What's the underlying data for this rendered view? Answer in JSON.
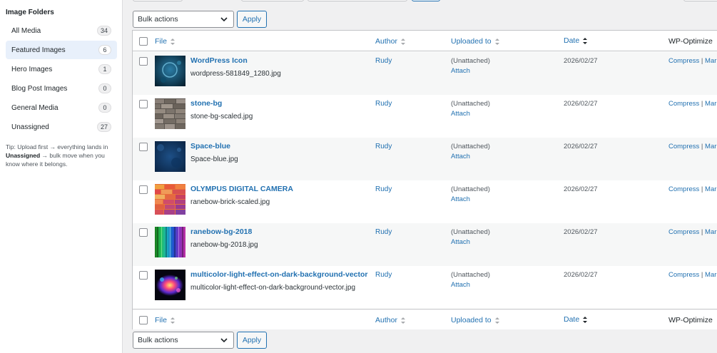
{
  "sidebar": {
    "title": "Image Folders",
    "folders": [
      {
        "label": "All Media",
        "count": "34"
      },
      {
        "label": "Featured Images",
        "count": "6"
      },
      {
        "label": "Hero Images",
        "count": "1"
      },
      {
        "label": "Blog Post Images",
        "count": "0"
      },
      {
        "label": "General Media",
        "count": "0"
      },
      {
        "label": "Unassigned",
        "count": "27"
      }
    ],
    "tip": {
      "part1": "Tip: Upload first → everything lands in ",
      "bold": "Unassigned",
      "part2": " → bulk move when you know where it belongs."
    }
  },
  "toolbar_top": {
    "bulk_label": "Bulk actions",
    "apply_label": "Apply"
  },
  "toolbar_bottom": {
    "bulk_label": "Bulk actions",
    "apply_label": "Apply"
  },
  "columns": {
    "file": "File",
    "author": "Author",
    "uploaded_to": "Uploaded to",
    "date": "Date",
    "wpo": "WP-Optimize"
  },
  "rows": [
    {
      "title": "WordPress Icon",
      "filename": "wordpress-581849_1280.jpg",
      "author": "Rudy",
      "uploaded": "(Unattached)",
      "attach": "Attach",
      "date": "2026/02/27",
      "compress": "Compress",
      "mark": "Mark",
      "thumb": "wordpress-icon-thumb"
    },
    {
      "title": "stone-bg",
      "filename": "stone-bg-scaled.jpg",
      "author": "Rudy",
      "uploaded": "(Unattached)",
      "attach": "Attach",
      "date": "2026/02/27",
      "compress": "Compress",
      "mark": "Mark",
      "thumb": "stone-wall-thumb"
    },
    {
      "title": "Space-blue",
      "filename": "Space-blue.jpg",
      "author": "Rudy",
      "uploaded": "(Unattached)",
      "attach": "Attach",
      "date": "2026/02/27",
      "compress": "Compress",
      "mark": "Mark",
      "thumb": "space-blue-thumb"
    },
    {
      "title": "OLYMPUS DIGITAL CAMERA",
      "filename": "ranebow-brick-scaled.jpg",
      "author": "Rudy",
      "uploaded": "(Unattached)",
      "attach": "Attach",
      "date": "2026/02/27",
      "compress": "Compress",
      "mark": "Mark",
      "thumb": "rainbow-brick-thumb"
    },
    {
      "title": "ranebow-bg-2018",
      "filename": "ranebow-bg-2018.jpg",
      "author": "Rudy",
      "uploaded": "(Unattached)",
      "attach": "Attach",
      "date": "2026/02/27",
      "compress": "Compress",
      "mark": "Mark",
      "thumb": "rainbow-stripes-thumb"
    },
    {
      "title": "multicolor-light-effect-on-dark-background-vector",
      "filename": "multicolor-light-effect-on-dark-background-vector.jpg",
      "author": "Rudy",
      "uploaded": "(Unattached)",
      "attach": "Attach",
      "date": "2026/02/27",
      "compress": "Compress",
      "mark": "Mark",
      "thumb": "light-effect-thumb"
    }
  ],
  "colors": {
    "accent": "#2271b1",
    "active_folder_bg": "#e8f0fb",
    "alt_row_bg": "#f6f7f7"
  }
}
